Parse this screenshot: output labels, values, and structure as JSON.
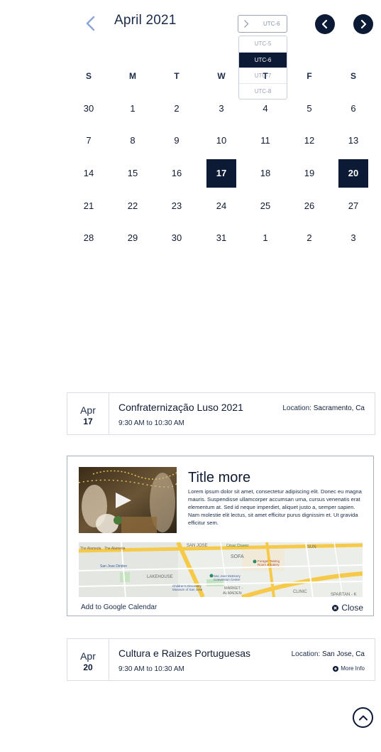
{
  "calendar": {
    "month_title": "April 2021",
    "weekdays": [
      "S",
      "M",
      "T",
      "W",
      "T",
      "F",
      "S"
    ],
    "weeks": [
      [
        "30",
        "1",
        "2",
        "3",
        "4",
        "5",
        "6"
      ],
      [
        "7",
        "8",
        "9",
        "10",
        "11",
        "12",
        "13"
      ],
      [
        "14",
        "15",
        "16",
        "17",
        "18",
        "19",
        "20"
      ],
      [
        "21",
        "22",
        "23",
        "24",
        "25",
        "26",
        "27"
      ],
      [
        "28",
        "29",
        "30",
        "31",
        "1",
        "2",
        "3"
      ]
    ],
    "highlighted_days": [
      "17",
      "20"
    ]
  },
  "timezone": {
    "current": "UTC-6",
    "options": [
      "UTC-5",
      "UTC-6",
      "UTC-7",
      "UTC-8"
    ],
    "selected": "UTC-6"
  },
  "icons": {
    "prev_month": "chevron-left-icon",
    "nav_left": "circle-chevron-left-icon",
    "nav_right": "circle-chevron-right-icon",
    "scroll_top": "circle-chevron-up-icon"
  },
  "events": [
    {
      "month": "Apr",
      "day": "17",
      "title": "Confraternização Luso 2021",
      "time": "9:30 AM to 10:30 AM",
      "location_label": "Location:",
      "location": "Sacramento, Ca"
    },
    {
      "month": "Apr",
      "day": "20",
      "title": "Cultura e Raizes Portuguesas",
      "time": "9:30 AM to 10:30 AM",
      "location_label": "Location:",
      "location": "San Jose, Ca",
      "more_info": "More Info"
    }
  ],
  "detail": {
    "title": "Title more",
    "description": "Lorem ipsum dolor sit amet, consectetur adipiscing elit. Donec eu magna mauris. Suspendisse ullamcorper accumsan urna, cursus venenatis erat elementum at. Sed id neque imperdiet, aliquet justo a, semper sapien. Nam molestie elit lectus, sit amet efficitur purus dignissim et. Ut gravida efficitur sem.",
    "add_to_calendar": "Add to Google Calendar",
    "close": "Close",
    "map_labels": [
      "The Alameda",
      "The Alameda",
      "SAN JOSE",
      "César Chavez",
      "SOFA",
      "SUN",
      "San Jose Diridon",
      "Forager Tasting Room & Eatery",
      "LAKEHOUSE",
      "San Jose McEnery Convention Center",
      "Children's Discovery Museum of San Jose",
      "MARKET - ALMADEN",
      "CLINIC",
      "SPARTAN - K"
    ]
  },
  "colors": {
    "navy": "#0c1a36",
    "text": "#1a2b49",
    "prev_arrow": "#8fa3d6",
    "border": "#d9dde5"
  }
}
